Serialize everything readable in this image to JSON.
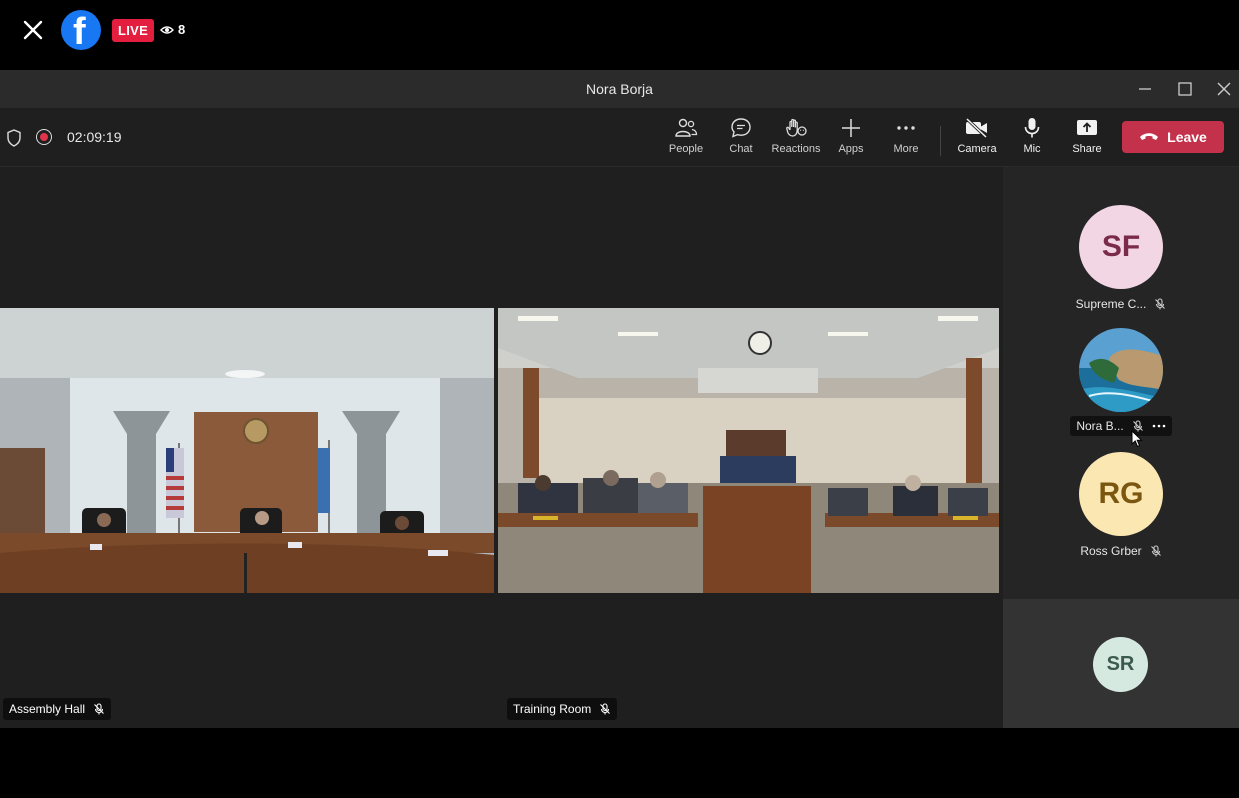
{
  "facebook": {
    "live_label": "LIVE",
    "viewer_count": "8",
    "logo_letter": "f"
  },
  "window": {
    "title": "Nora Borja"
  },
  "toolbar": {
    "timer": "02:09:19",
    "buttons": [
      {
        "label": "People",
        "icon": "people-icon"
      },
      {
        "label": "Chat",
        "icon": "chat-icon"
      },
      {
        "label": "Reactions",
        "icon": "reactions-icon"
      },
      {
        "label": "Apps",
        "icon": "apps-icon"
      },
      {
        "label": "More",
        "icon": "more-icon"
      },
      {
        "label": "Camera",
        "icon": "camera-off-icon"
      },
      {
        "label": "Mic",
        "icon": "mic-icon"
      },
      {
        "label": "Share",
        "icon": "share-icon"
      }
    ],
    "leave_label": "Leave"
  },
  "stage": {
    "tiles": [
      {
        "name": "Assembly Hall"
      },
      {
        "name": "Training Room"
      }
    ]
  },
  "roster": {
    "participants": [
      {
        "initials": "SF",
        "name": "Supreme C...",
        "bg": "#f3d6e4",
        "fg": "#7a2b4a"
      },
      {
        "initials": "",
        "name": "Nora B...",
        "bg": "#3a7fa8",
        "fg": "#ffffff"
      },
      {
        "initials": "RG",
        "name": "Ross Grber",
        "bg": "#fbe7b2",
        "fg": "#7a5610"
      },
      {
        "initials": "SR",
        "name": "",
        "bg": "#d6e9e0",
        "fg": "#3a5a4e"
      }
    ]
  },
  "colors": {
    "accent_red": "#c4314b",
    "live_red": "#e41e3f",
    "facebook_blue": "#1877f2"
  }
}
